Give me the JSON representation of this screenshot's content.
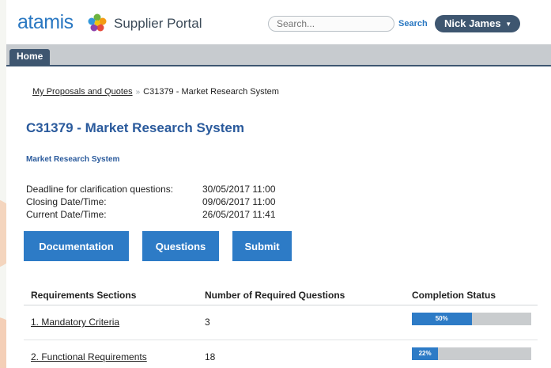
{
  "header": {
    "logo_text": "atamis",
    "portal_title": "Supplier Portal",
    "search_placeholder": "Search...",
    "search_link": "Search",
    "user_name": "Nick James"
  },
  "nav": {
    "home_tab": "Home"
  },
  "breadcrumb": {
    "link": "My Proposals and Quotes",
    "separator": "»",
    "current": "C31379 - Market Research System"
  },
  "page_title": "C31379 - Market Research System",
  "subtitle": "Market Research System",
  "dates": [
    {
      "label": "Deadline for clarification questions:",
      "value": "30/05/2017 11:00"
    },
    {
      "label": "Closing Date/Time:",
      "value": "09/06/2017 11:00"
    },
    {
      "label": "Current Date/Time:",
      "value": "26/05/2017 11:41"
    }
  ],
  "buttons": {
    "documentation": "Documentation",
    "questions": "Questions",
    "submit": "Submit"
  },
  "table": {
    "headers": [
      "Requirements Sections",
      "Number of Required Questions",
      "Completion Status"
    ],
    "rows": [
      {
        "section": "1. Mandatory Criteria",
        "count": "3",
        "progress_label": "50%",
        "progress": 0.5
      },
      {
        "section": "2. Functional Requirements",
        "count": "18",
        "progress_label": "22%",
        "progress": 0.22
      }
    ]
  },
  "colors": {
    "brand_blue": "#2a78c2",
    "button_blue": "#2d7bc6",
    "nav_dark": "#3e5670",
    "title_blue": "#2a5a9c"
  }
}
